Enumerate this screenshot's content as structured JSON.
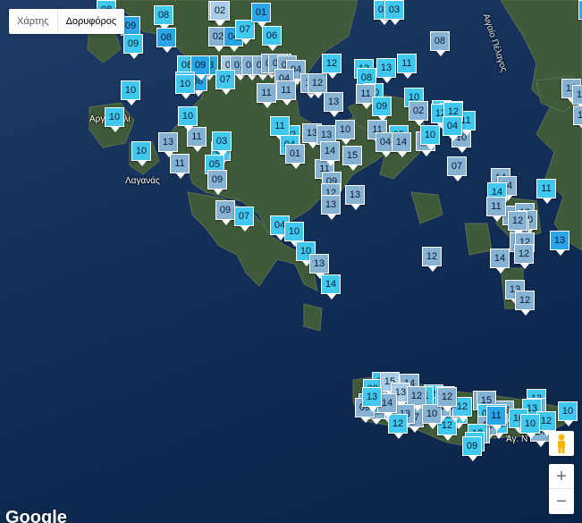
{
  "map_type_control": {
    "map_label": "Χάρτης",
    "satellite_label": "Δορυφόρος",
    "active": "satellite"
  },
  "place_labels": {
    "argostoli": "Αργοστόλι",
    "lagana": "Λαγανάς",
    "aegean_sea": "Αιγαίο Πέλαγος",
    "agios_nikolaos": "Άγ. Ν"
  },
  "zoom_control": {
    "zoom_in": "+",
    "zoom_out": "−"
  },
  "logo": "Google",
  "colors": {
    "marker_light": "#41c8ee",
    "marker_mid": "#2aa6e8",
    "marker_muted": "#86b3d3",
    "marker_pale": "#a9cde6",
    "sea_dark": "#0f2a52",
    "land": "#3f5a38"
  },
  "markers": [
    "08",
    "09",
    "08",
    "08",
    "02",
    "04",
    "07",
    "01",
    "06",
    "01",
    "01",
    "03",
    "05",
    "02",
    "05",
    "00",
    "01",
    "04",
    "04",
    "08",
    "03",
    "08",
    "09",
    "09",
    "07",
    "07",
    "10",
    "10",
    "10",
    "10",
    "11",
    "11",
    "11",
    "12",
    "13",
    "13",
    "11",
    "13",
    "11",
    "10",
    "12",
    "10",
    "12",
    "13",
    "11",
    "08",
    "10",
    "11",
    "09",
    "10",
    "08",
    "02",
    "03",
    "06",
    "07",
    "03",
    "10",
    "02",
    "05",
    "11",
    "04",
    "14",
    "13",
    "11",
    "09",
    "02",
    "11",
    "04",
    "01",
    "05",
    "03",
    "05",
    "09",
    "09",
    "07",
    "04",
    "10",
    "10",
    "13",
    "14",
    "14",
    "12",
    "13",
    "13",
    "15",
    "14",
    "14",
    "11",
    "13",
    "10",
    "13",
    "12",
    "11",
    "13",
    "12",
    "12",
    "07",
    "14",
    "12",
    "13",
    "10",
    "12",
    "14",
    "11",
    "12",
    "13",
    "14",
    "14",
    "12",
    "11",
    "11",
    "12",
    "13",
    "10",
    "08",
    "09",
    "10",
    "14",
    "15",
    "13",
    "10",
    "12",
    "10",
    "09",
    "11",
    "10",
    "11",
    "12",
    "12",
    "12",
    "09",
    "10",
    "12",
    "11",
    "09",
    "12",
    "11",
    "08",
    "07",
    "11",
    "10",
    "11",
    "06",
    "09",
    "12",
    "08",
    "09",
    "14",
    "15",
    "13",
    "06",
    "11",
    "12",
    "12",
    "10",
    "13",
    "12",
    "14",
    "13",
    "12",
    "11",
    "07",
    "02",
    "12",
    "04"
  ]
}
